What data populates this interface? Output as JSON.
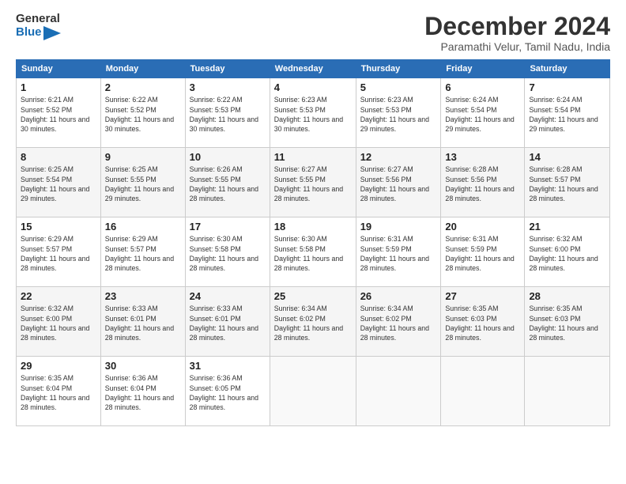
{
  "logo": {
    "line1": "General",
    "line2": "Blue"
  },
  "title": "December 2024",
  "location": "Paramathi Velur, Tamil Nadu, India",
  "weekdays": [
    "Sunday",
    "Monday",
    "Tuesday",
    "Wednesday",
    "Thursday",
    "Friday",
    "Saturday"
  ],
  "weeks": [
    [
      {
        "day": "1",
        "sunrise": "6:21 AM",
        "sunset": "5:52 PM",
        "daylight": "11 hours and 30 minutes."
      },
      {
        "day": "2",
        "sunrise": "6:22 AM",
        "sunset": "5:52 PM",
        "daylight": "11 hours and 30 minutes."
      },
      {
        "day": "3",
        "sunrise": "6:22 AM",
        "sunset": "5:53 PM",
        "daylight": "11 hours and 30 minutes."
      },
      {
        "day": "4",
        "sunrise": "6:23 AM",
        "sunset": "5:53 PM",
        "daylight": "11 hours and 30 minutes."
      },
      {
        "day": "5",
        "sunrise": "6:23 AM",
        "sunset": "5:53 PM",
        "daylight": "11 hours and 29 minutes."
      },
      {
        "day": "6",
        "sunrise": "6:24 AM",
        "sunset": "5:54 PM",
        "daylight": "11 hours and 29 minutes."
      },
      {
        "day": "7",
        "sunrise": "6:24 AM",
        "sunset": "5:54 PM",
        "daylight": "11 hours and 29 minutes."
      }
    ],
    [
      {
        "day": "8",
        "sunrise": "6:25 AM",
        "sunset": "5:54 PM",
        "daylight": "11 hours and 29 minutes."
      },
      {
        "day": "9",
        "sunrise": "6:25 AM",
        "sunset": "5:55 PM",
        "daylight": "11 hours and 29 minutes."
      },
      {
        "day": "10",
        "sunrise": "6:26 AM",
        "sunset": "5:55 PM",
        "daylight": "11 hours and 28 minutes."
      },
      {
        "day": "11",
        "sunrise": "6:27 AM",
        "sunset": "5:55 PM",
        "daylight": "11 hours and 28 minutes."
      },
      {
        "day": "12",
        "sunrise": "6:27 AM",
        "sunset": "5:56 PM",
        "daylight": "11 hours and 28 minutes."
      },
      {
        "day": "13",
        "sunrise": "6:28 AM",
        "sunset": "5:56 PM",
        "daylight": "11 hours and 28 minutes."
      },
      {
        "day": "14",
        "sunrise": "6:28 AM",
        "sunset": "5:57 PM",
        "daylight": "11 hours and 28 minutes."
      }
    ],
    [
      {
        "day": "15",
        "sunrise": "6:29 AM",
        "sunset": "5:57 PM",
        "daylight": "11 hours and 28 minutes."
      },
      {
        "day": "16",
        "sunrise": "6:29 AM",
        "sunset": "5:57 PM",
        "daylight": "11 hours and 28 minutes."
      },
      {
        "day": "17",
        "sunrise": "6:30 AM",
        "sunset": "5:58 PM",
        "daylight": "11 hours and 28 minutes."
      },
      {
        "day": "18",
        "sunrise": "6:30 AM",
        "sunset": "5:58 PM",
        "daylight": "11 hours and 28 minutes."
      },
      {
        "day": "19",
        "sunrise": "6:31 AM",
        "sunset": "5:59 PM",
        "daylight": "11 hours and 28 minutes."
      },
      {
        "day": "20",
        "sunrise": "6:31 AM",
        "sunset": "5:59 PM",
        "daylight": "11 hours and 28 minutes."
      },
      {
        "day": "21",
        "sunrise": "6:32 AM",
        "sunset": "6:00 PM",
        "daylight": "11 hours and 28 minutes."
      }
    ],
    [
      {
        "day": "22",
        "sunrise": "6:32 AM",
        "sunset": "6:00 PM",
        "daylight": "11 hours and 28 minutes."
      },
      {
        "day": "23",
        "sunrise": "6:33 AM",
        "sunset": "6:01 PM",
        "daylight": "11 hours and 28 minutes."
      },
      {
        "day": "24",
        "sunrise": "6:33 AM",
        "sunset": "6:01 PM",
        "daylight": "11 hours and 28 minutes."
      },
      {
        "day": "25",
        "sunrise": "6:34 AM",
        "sunset": "6:02 PM",
        "daylight": "11 hours and 28 minutes."
      },
      {
        "day": "26",
        "sunrise": "6:34 AM",
        "sunset": "6:02 PM",
        "daylight": "11 hours and 28 minutes."
      },
      {
        "day": "27",
        "sunrise": "6:35 AM",
        "sunset": "6:03 PM",
        "daylight": "11 hours and 28 minutes."
      },
      {
        "day": "28",
        "sunrise": "6:35 AM",
        "sunset": "6:03 PM",
        "daylight": "11 hours and 28 minutes."
      }
    ],
    [
      {
        "day": "29",
        "sunrise": "6:35 AM",
        "sunset": "6:04 PM",
        "daylight": "11 hours and 28 minutes."
      },
      {
        "day": "30",
        "sunrise": "6:36 AM",
        "sunset": "6:04 PM",
        "daylight": "11 hours and 28 minutes."
      },
      {
        "day": "31",
        "sunrise": "6:36 AM",
        "sunset": "6:05 PM",
        "daylight": "11 hours and 28 minutes."
      },
      null,
      null,
      null,
      null
    ]
  ],
  "labels": {
    "sunrise": "Sunrise: ",
    "sunset": "Sunset: ",
    "daylight": "Daylight: "
  }
}
